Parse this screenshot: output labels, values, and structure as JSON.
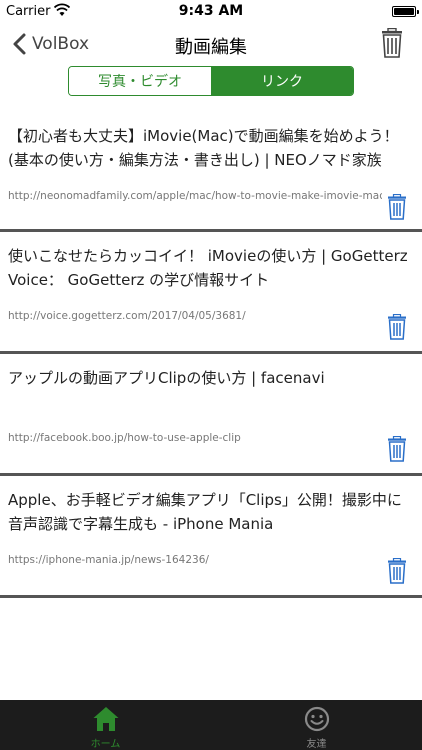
{
  "status_bar": {
    "carrier": "Carrier",
    "time": "9:43 AM"
  },
  "nav": {
    "back_label": "VolBox",
    "title": "動画編集"
  },
  "segments": [
    "写真・ビデオ",
    "リンク"
  ],
  "selected_segment": "リンク",
  "links": [
    {
      "title": "【初心者も大丈夫】iMovie(Mac)で動画編集を始めよう！(基本の使い方・編集方法・書き出し) | NEOノマド家族",
      "url": "http://neonomadfamily.com/apple/mac/how-to-movie-make-imovie-mac/"
    },
    {
      "title": "使いこなせたらカッコイイ！ iMovieの使い方 | GoGetterz Voice： GoGetterz の学び情報サイト",
      "url": "http://voice.gogetterz.com/2017/04/05/3681/"
    },
    {
      "title": "アップルの動画アプリClipの使い方 | facenavi",
      "url": "http://facebook.boo.jp/how-to-use-apple-clip"
    },
    {
      "title": "Apple、お手軽ビデオ編集アプリ「Clips」公開！撮影中に音声認識で字幕生成も - iPhone Mania",
      "url": "https://iphone-mania.jp/news-164236/"
    }
  ],
  "tabs": [
    {
      "label": "ホーム",
      "icon": "home-icon"
    },
    {
      "label": "友達",
      "icon": "smiley-icon"
    }
  ],
  "colors": {
    "accent": "#2e8b2e",
    "trash_blue": "#2a6fc9",
    "tab_bar": "#1c1c1c",
    "separator": "#555555"
  }
}
